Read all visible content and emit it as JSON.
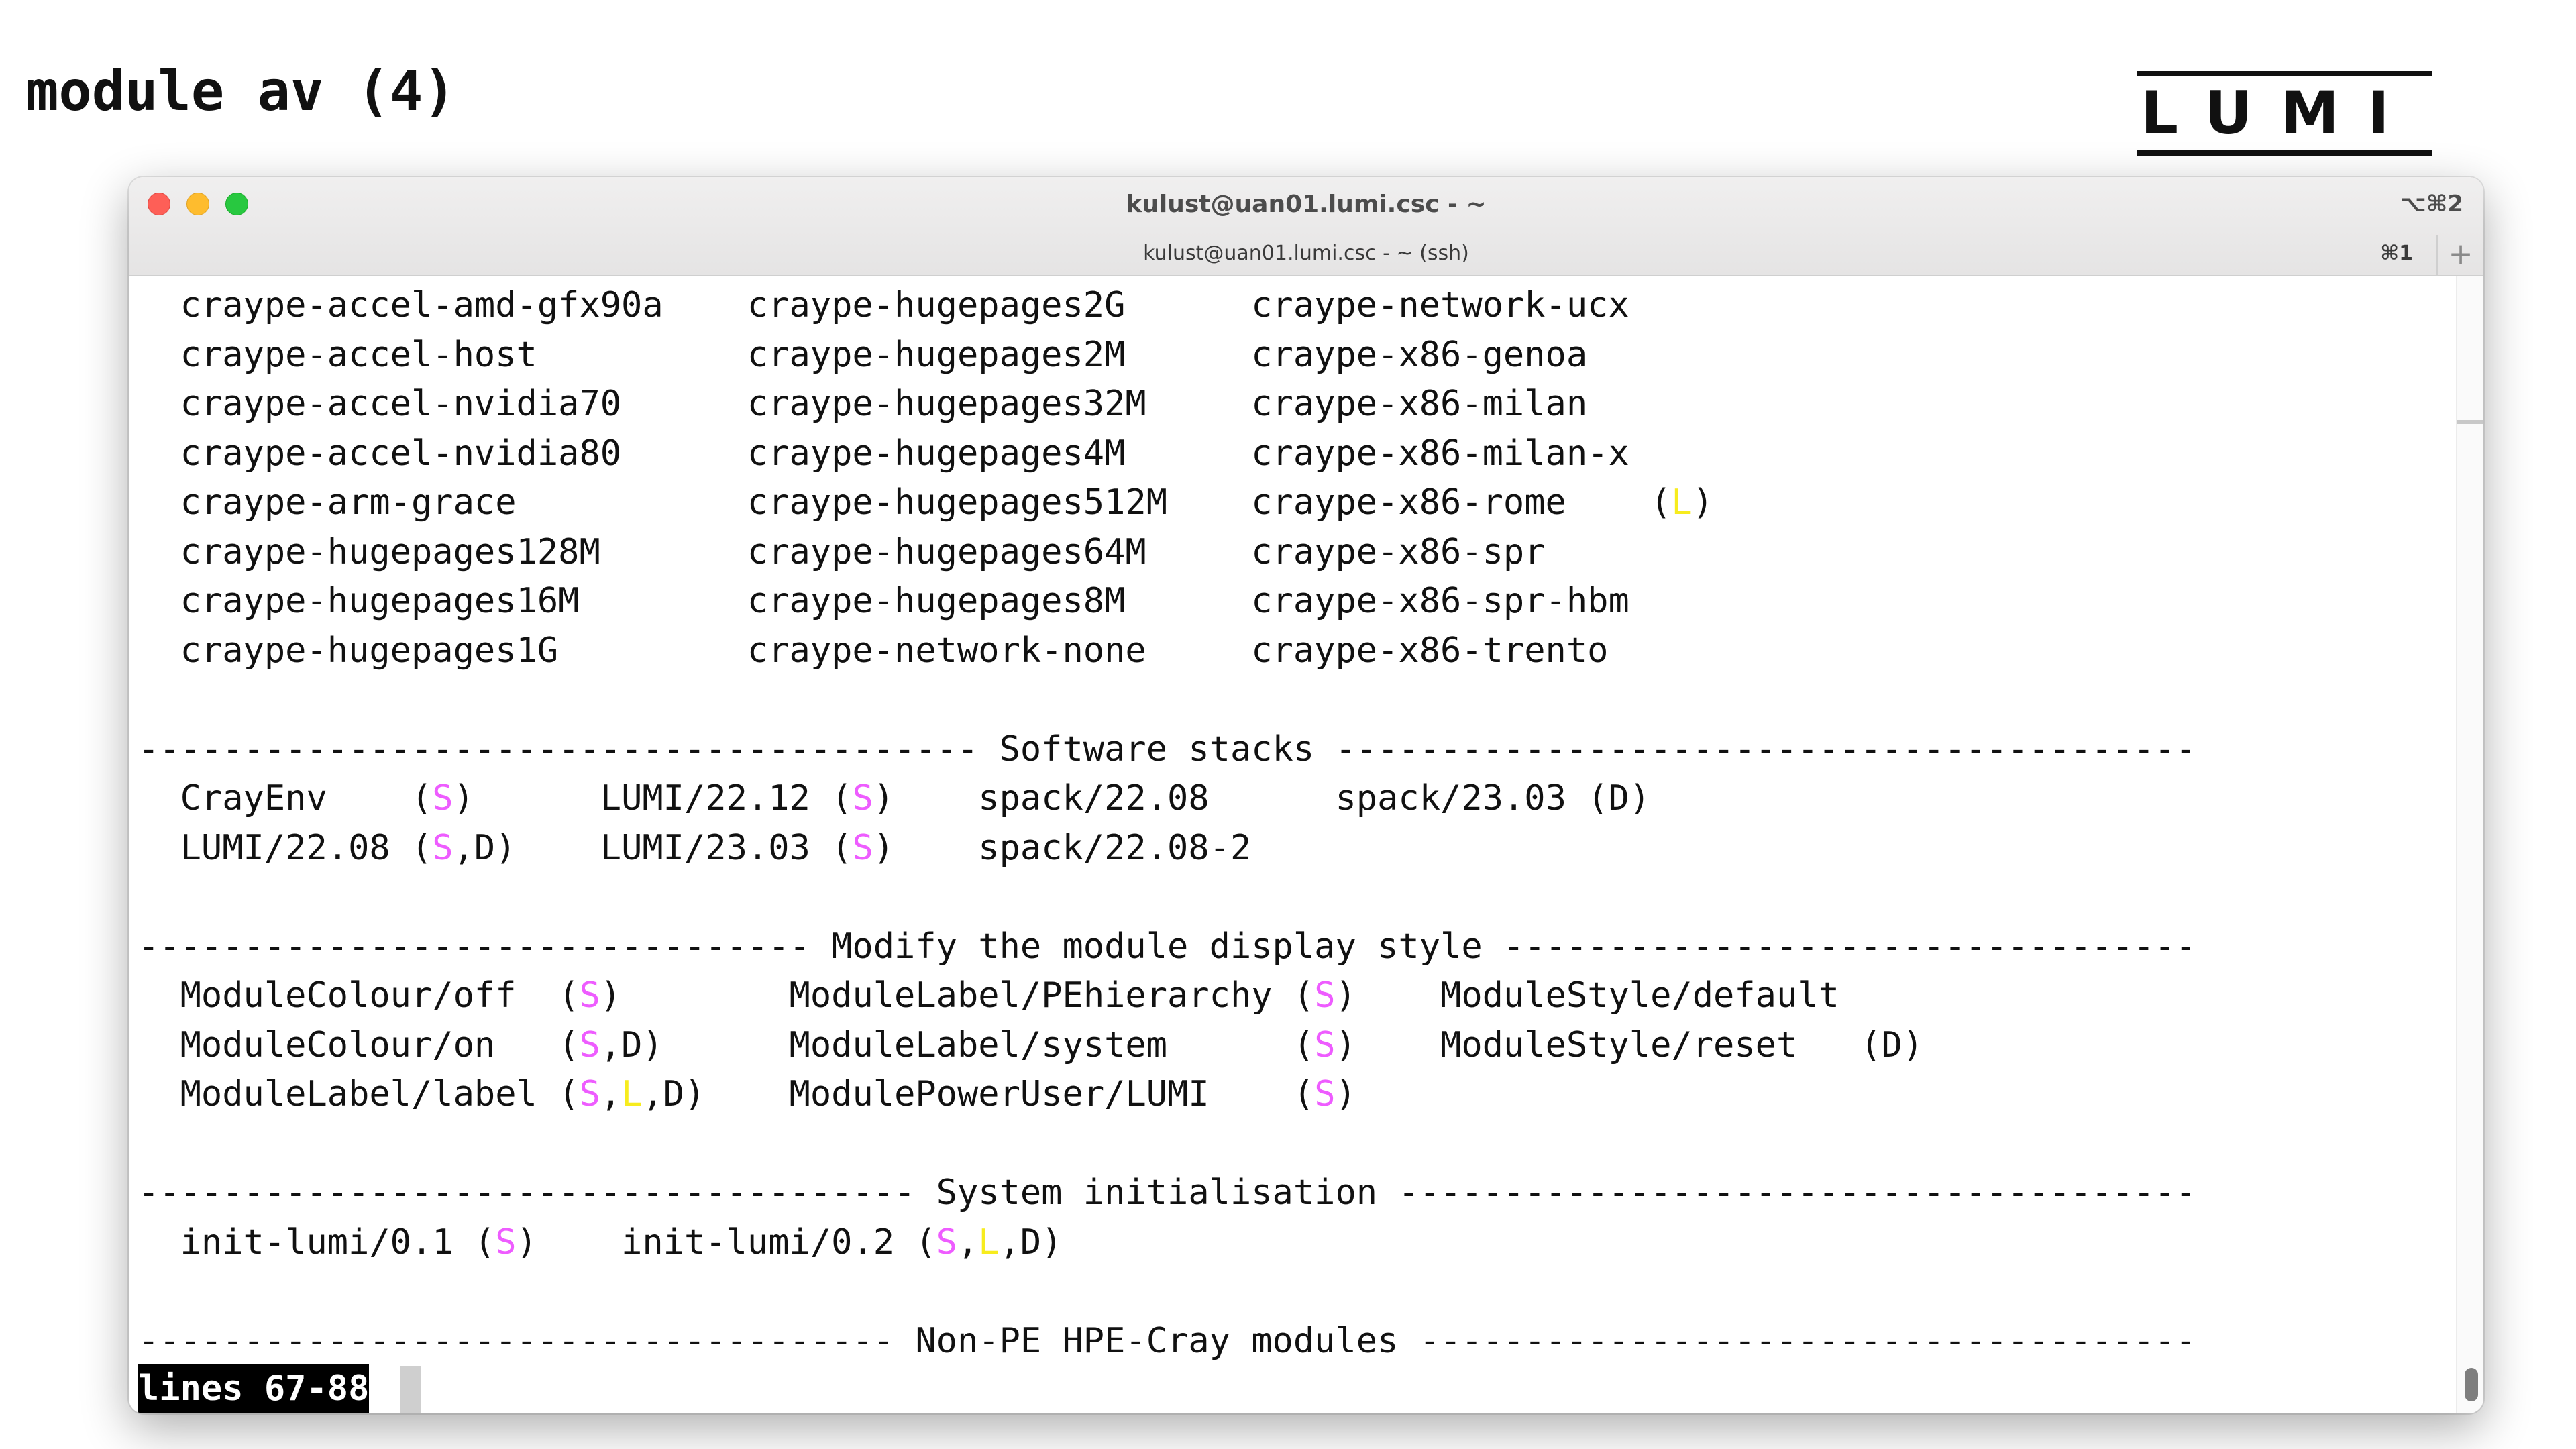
{
  "slide": {
    "title": "module av (4)",
    "logo_text": "LUMI"
  },
  "window": {
    "title": "kulust@uan01.lumi.csc - ~",
    "shortcut": "⌥⌘2",
    "tab_title": "kulust@uan01.lumi.csc - ~ (ssh)",
    "tab_shortcut": "⌘1",
    "new_tab_label": "+"
  },
  "terminal": {
    "lines": [
      [
        {
          "t": "  craype-accel-amd-gfx90a    craype-hugepages2G      craype-network-ucx"
        }
      ],
      [
        {
          "t": "  craype-accel-host          craype-hugepages2M      craype-x86-genoa"
        }
      ],
      [
        {
          "t": "  craype-accel-nvidia70      craype-hugepages32M     craype-x86-milan"
        }
      ],
      [
        {
          "t": "  craype-accel-nvidia80      craype-hugepages4M      craype-x86-milan-x"
        }
      ],
      [
        {
          "t": "  craype-arm-grace           craype-hugepages512M    craype-x86-rome    ("
        },
        {
          "t": "L",
          "c": "yl"
        },
        {
          "t": ")"
        }
      ],
      [
        {
          "t": "  craype-hugepages128M       craype-hugepages64M     craype-x86-spr"
        }
      ],
      [
        {
          "t": "  craype-hugepages16M        craype-hugepages8M      craype-x86-spr-hbm"
        }
      ],
      [
        {
          "t": "  craype-hugepages1G         craype-network-none     craype-x86-trento"
        }
      ],
      [
        {
          "t": ""
        }
      ],
      [
        {
          "t": "---------------------------------------- Software stacks -----------------------------------------"
        }
      ],
      [
        {
          "t": "  CrayEnv    ("
        },
        {
          "t": "S",
          "c": "pk"
        },
        {
          "t": ")      LUMI/22.12 ("
        },
        {
          "t": "S",
          "c": "pk"
        },
        {
          "t": ")    spack/22.08      spack/23.03 (D)"
        }
      ],
      [
        {
          "t": "  LUMI/22.08 ("
        },
        {
          "t": "S",
          "c": "pk"
        },
        {
          "t": ",D)    LUMI/23.03 ("
        },
        {
          "t": "S",
          "c": "pk"
        },
        {
          "t": ")    spack/22.08-2"
        }
      ],
      [
        {
          "t": ""
        }
      ],
      [
        {
          "t": "-------------------------------- Modify the module display style ---------------------------------"
        }
      ],
      [
        {
          "t": "  ModuleColour/off  ("
        },
        {
          "t": "S",
          "c": "pk"
        },
        {
          "t": ")        ModuleLabel/PEhierarchy ("
        },
        {
          "t": "S",
          "c": "pk"
        },
        {
          "t": ")    ModuleStyle/default"
        }
      ],
      [
        {
          "t": "  ModuleColour/on   ("
        },
        {
          "t": "S",
          "c": "pk"
        },
        {
          "t": ",D)      ModuleLabel/system      ("
        },
        {
          "t": "S",
          "c": "pk"
        },
        {
          "t": ")    ModuleStyle/reset   (D)"
        }
      ],
      [
        {
          "t": "  ModuleLabel/label ("
        },
        {
          "t": "S",
          "c": "pk"
        },
        {
          "t": ","
        },
        {
          "t": "L",
          "c": "yl"
        },
        {
          "t": ",D)    ModulePowerUser/LUMI    ("
        },
        {
          "t": "S",
          "c": "pk"
        },
        {
          "t": ")"
        }
      ],
      [
        {
          "t": ""
        }
      ],
      [
        {
          "t": "------------------------------------- System initialisation --------------------------------------"
        }
      ],
      [
        {
          "t": "  init-lumi/0.1 ("
        },
        {
          "t": "S",
          "c": "pk"
        },
        {
          "t": ")    init-lumi/0.2 ("
        },
        {
          "t": "S",
          "c": "pk"
        },
        {
          "t": ","
        },
        {
          "t": "L",
          "c": "yl"
        },
        {
          "t": ",D)"
        }
      ],
      [
        {
          "t": ""
        }
      ],
      [
        {
          "t": "------------------------------------ Non-PE HPE-Cray modules -------------------------------------"
        }
      ]
    ],
    "pager_status": "lines 67-88"
  },
  "colors": {
    "sticky_marker": "#ee5cff",
    "loaded_marker": "#f7ec1e",
    "traffic_close": "#fe5f57",
    "traffic_minimize": "#febc2e",
    "traffic_maximize": "#28c840"
  }
}
